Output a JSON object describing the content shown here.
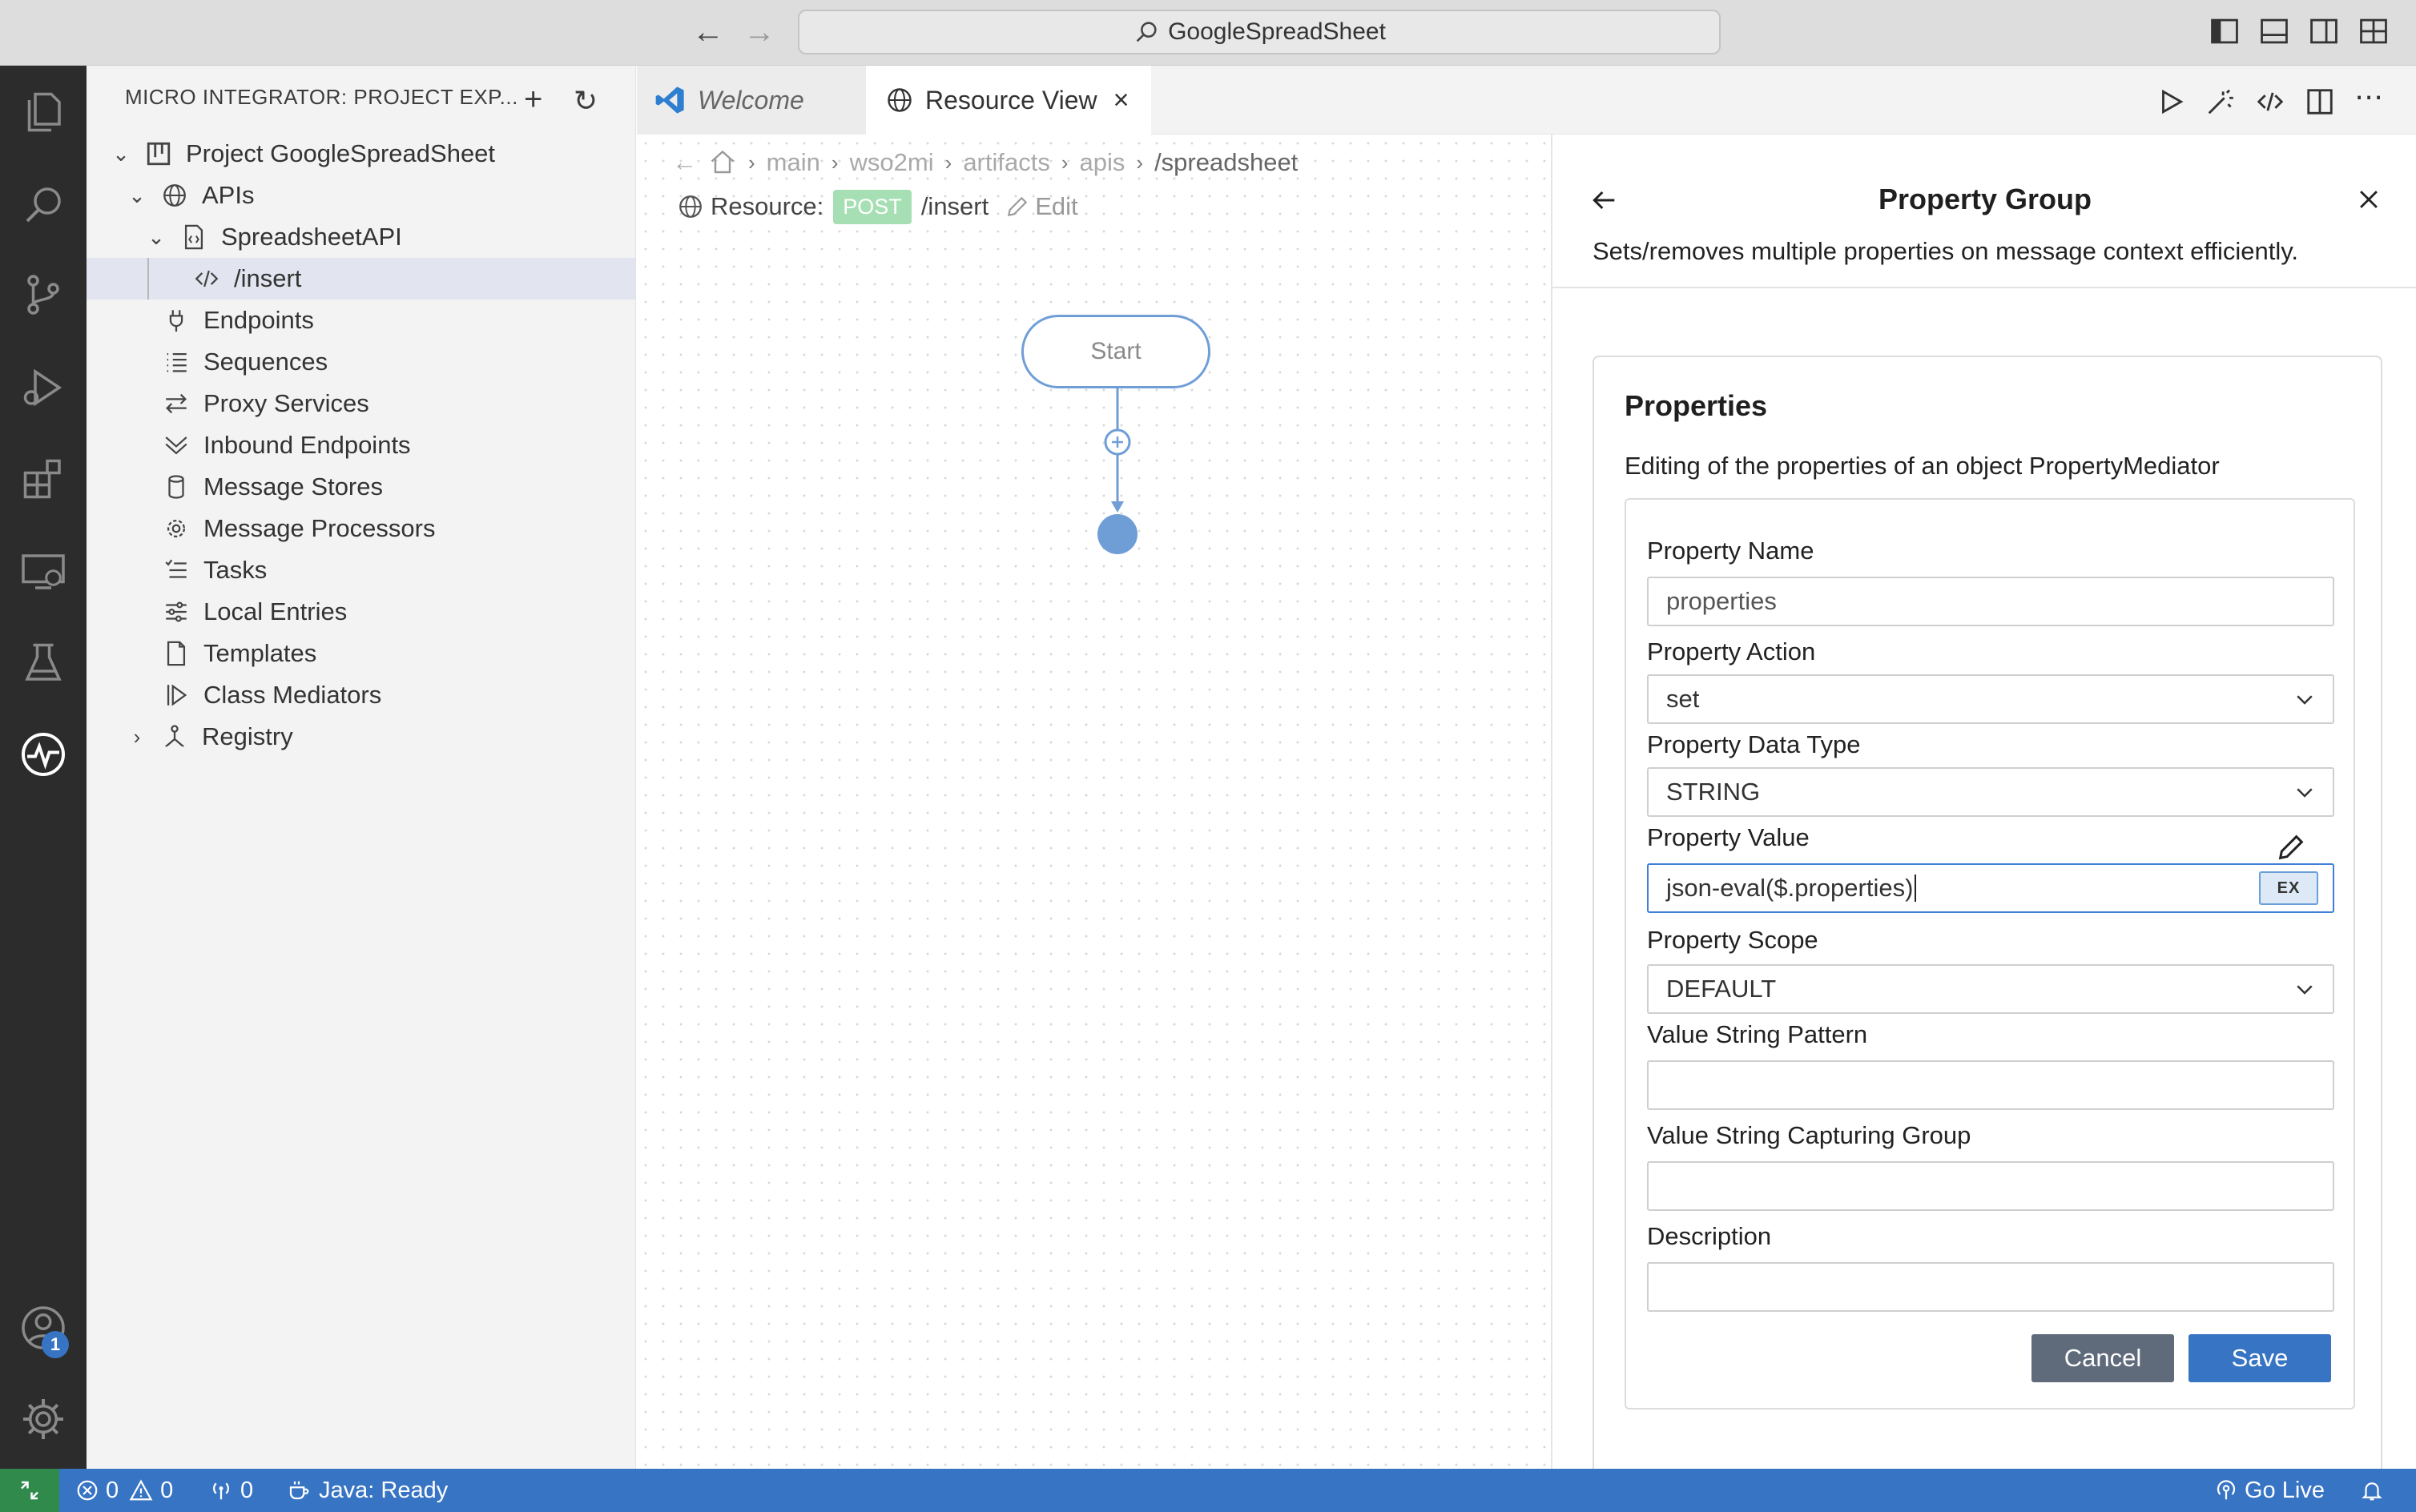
{
  "window": {
    "title": "GoogleSpreadSheet"
  },
  "explorer": {
    "header": "MICRO INTEGRATOR: PROJECT EXP...",
    "tree": [
      {
        "label": "Project GoogleSpreadSheet",
        "icon": "project-icon"
      },
      {
        "label": "APIs",
        "icon": "globe-icon"
      },
      {
        "label": "SpreadsheetAPI",
        "icon": "api-file-icon"
      },
      {
        "label": "/insert",
        "icon": "code-icon",
        "selected": true
      },
      {
        "label": "Endpoints",
        "icon": "plug-icon"
      },
      {
        "label": "Sequences",
        "icon": "list-icon"
      },
      {
        "label": "Proxy Services",
        "icon": "arrows-icon"
      },
      {
        "label": "Inbound Endpoints",
        "icon": "inbound-icon"
      },
      {
        "label": "Message Stores",
        "icon": "database-icon"
      },
      {
        "label": "Message Processors",
        "icon": "gear-icon"
      },
      {
        "label": "Tasks",
        "icon": "tasks-icon"
      },
      {
        "label": "Local Entries",
        "icon": "sliders-icon"
      },
      {
        "label": "Templates",
        "icon": "file-icon"
      },
      {
        "label": "Class Mediators",
        "icon": "class-mediator-icon"
      },
      {
        "label": "Registry",
        "icon": "registry-icon"
      }
    ]
  },
  "tabs": [
    {
      "label": "Welcome",
      "active": false
    },
    {
      "label": "Resource View",
      "active": true
    }
  ],
  "editor": {
    "breadcrumb": [
      "main",
      "wso2mi",
      "artifacts",
      "apis",
      "/spreadsheet"
    ],
    "resource_label": "Resource:",
    "method": "POST",
    "path": "/insert",
    "edit_label": "Edit",
    "start_node": "Start"
  },
  "panel": {
    "title": "Property Group",
    "description": "Sets/removes multiple properties on message context efficiently.",
    "card_title": "Properties",
    "card_subtitle": "Editing of the properties of an object PropertyMediator",
    "fields": {
      "property_name": {
        "label": "Property Name",
        "placeholder": "properties"
      },
      "property_action": {
        "label": "Property Action",
        "value": "set"
      },
      "property_data_type": {
        "label": "Property Data Type",
        "value": "STRING"
      },
      "property_value": {
        "label": "Property Value",
        "value": "json-eval($.properties)",
        "ex_label": "EX"
      },
      "property_scope": {
        "label": "Property Scope",
        "value": "DEFAULT"
      },
      "value_string_pattern": {
        "label": "Value String Pattern",
        "value": ""
      },
      "value_string_capturing_group": {
        "label": "Value String Capturing Group",
        "value": ""
      },
      "description": {
        "label": "Description",
        "value": ""
      }
    },
    "cancel_label": "Cancel",
    "save_label": "Save"
  },
  "statusbar": {
    "errors": "0",
    "warnings": "0",
    "ports": "0",
    "java_status": "Java: Ready",
    "go_live": "Go Live"
  },
  "badges": {
    "accounts": "1"
  },
  "colors": {
    "accent": "#3774c4",
    "activity_bar": "#2c2c2c",
    "post_badge": "#a7dfb4",
    "cancel_button": "#5f6b7a",
    "remote_indicator": "#2f8a4b"
  }
}
